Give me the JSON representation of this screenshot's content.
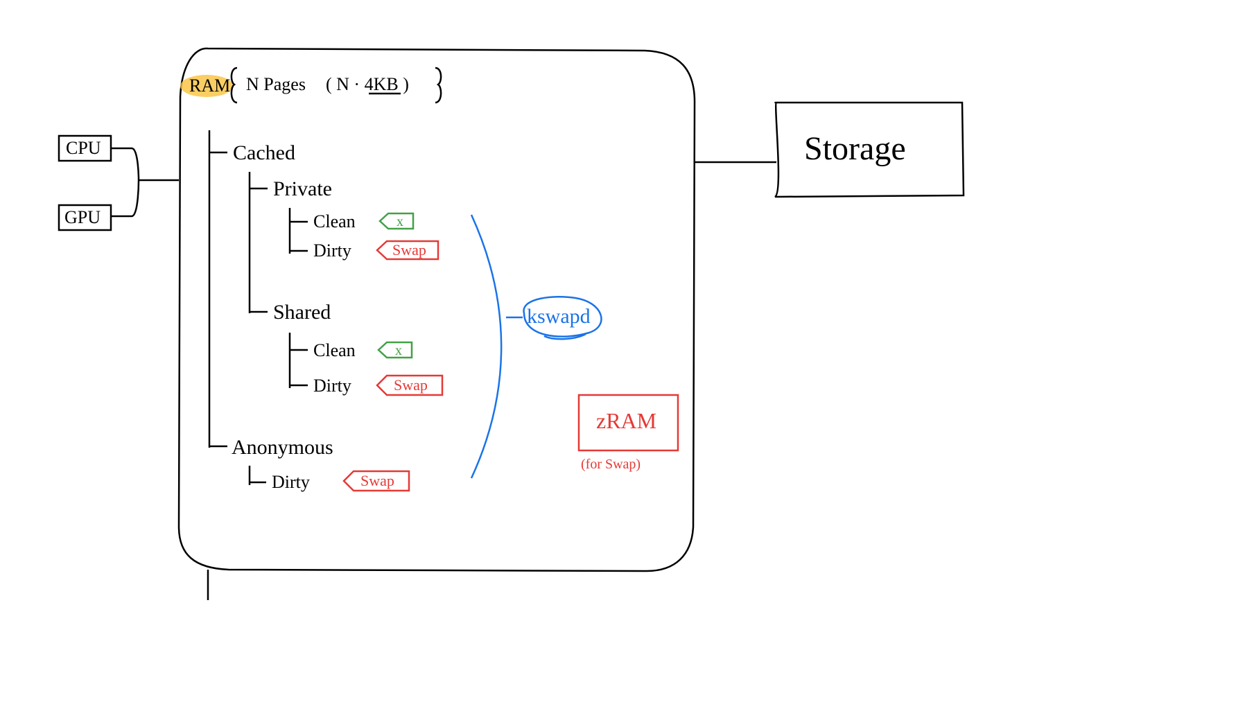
{
  "left": {
    "cpu": "CPU",
    "gpu": "GPU"
  },
  "ram": {
    "label": "RAM",
    "header_pages": "N Pages",
    "header_size": "( N · 4KB )",
    "tree": {
      "cached": {
        "label": "Cached",
        "private": {
          "label": "Private",
          "clean": {
            "label": "Clean",
            "tag": "x"
          },
          "dirty": {
            "label": "Dirty",
            "tag": "Swap"
          }
        },
        "shared": {
          "label": "Shared",
          "clean": {
            "label": "Clean",
            "tag": "x"
          },
          "dirty": {
            "label": "Dirty",
            "tag": "Swap"
          }
        }
      },
      "anonymous": {
        "label": "Anonymous",
        "dirty": {
          "label": "Dirty",
          "tag": "Swap"
        }
      }
    },
    "kswapd": "kswapd",
    "zram": {
      "title": "zRAM",
      "note": "(for Swap)"
    }
  },
  "storage": {
    "label": "Storage"
  },
  "colors": {
    "highlight": "#f9c23c",
    "blue": "#1a73e8",
    "red": "#e53935",
    "green": "#43a047",
    "black": "#000000"
  }
}
